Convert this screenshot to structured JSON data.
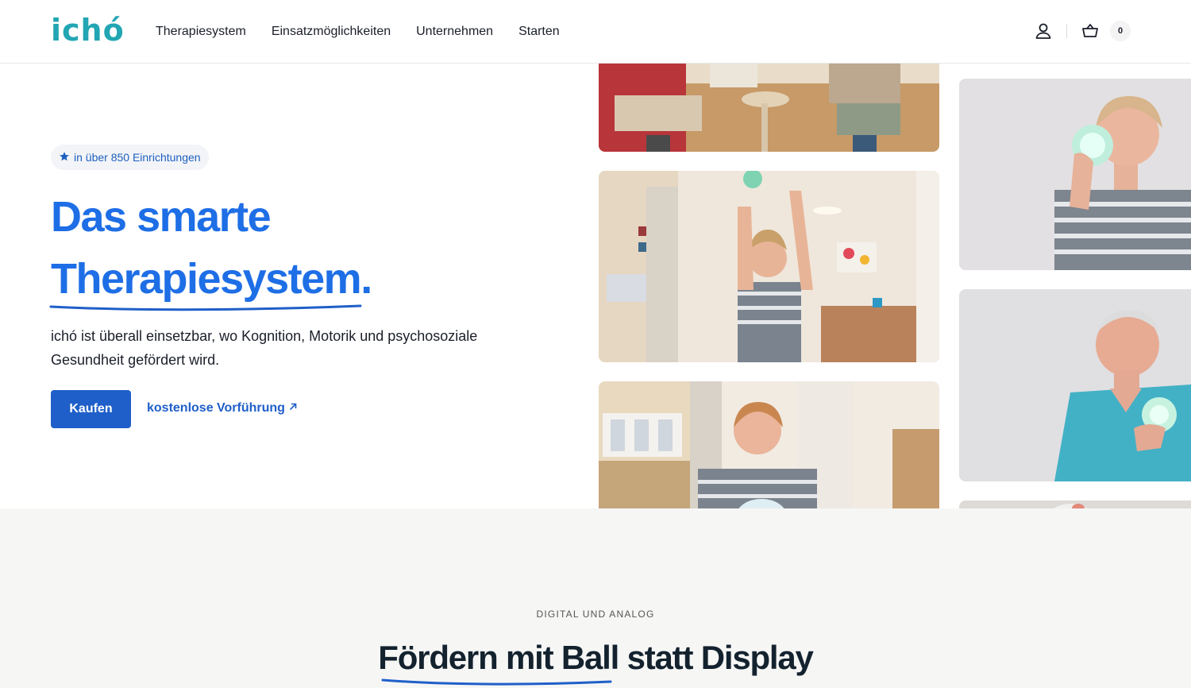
{
  "header": {
    "logo_text": "ichó",
    "nav": [
      "Therapiesystem",
      "Einsatzmöglichkeiten",
      "Unternehmen",
      "Starten"
    ],
    "account_icon": "user-icon",
    "cart_icon": "basket-icon",
    "cart_count": "0"
  },
  "hero": {
    "badge_icon": "star-icon",
    "badge_text": "in über 850 Einrichtungen",
    "title_line1": "Das smarte",
    "title_line2": "Therapiesystem.",
    "description": "ichó ist überall einsetzbar, wo Kognition, Motorik und psychosoziale Gesundheit gefördert wird.",
    "buy_label": "Kaufen",
    "demo_label": "kostenlose Vorführung",
    "demo_icon": "arrow-up-right-icon"
  },
  "section2": {
    "eyebrow": "DIGITAL UND ANALOG",
    "title": "Fördern mit Ball statt Display"
  },
  "colors": {
    "brand_teal": "#22a6b3",
    "accent_blue": "#1e6ee6",
    "button_blue": "#1f5fc9"
  }
}
